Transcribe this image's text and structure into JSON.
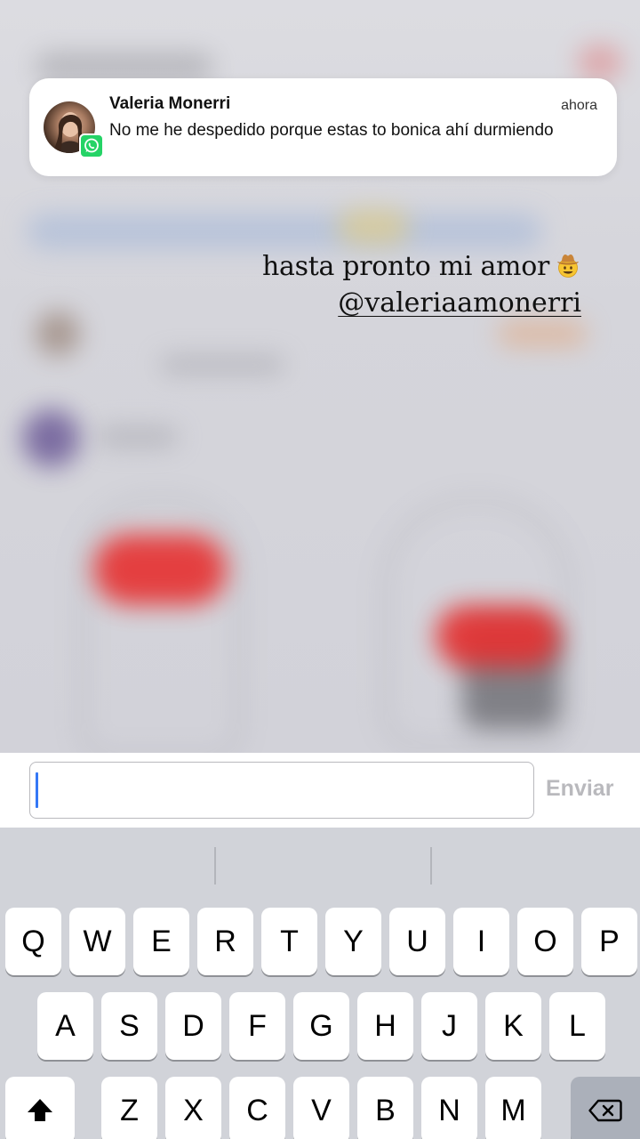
{
  "notification": {
    "sender": "Valeria Monerri",
    "time": "ahora",
    "message": "No me he despedido porque estas to bonica ahí durmiendo",
    "avatar_icon": "profile-photo",
    "app_icon": "whatsapp-icon"
  },
  "story": {
    "caption": "hasta pronto mi amor",
    "caption_emoji": "cowboy-hat-face-emoji",
    "mention": "@valeriaamonerri"
  },
  "reply": {
    "input_value": "",
    "send_label": "Enviar"
  },
  "keyboard": {
    "row1": [
      "Q",
      "W",
      "E",
      "R",
      "T",
      "Y",
      "U",
      "I",
      "O",
      "P"
    ],
    "row2": [
      "A",
      "S",
      "D",
      "F",
      "G",
      "H",
      "J",
      "K",
      "L"
    ],
    "row3": [
      "Z",
      "X",
      "C",
      "V",
      "B",
      "N",
      "M"
    ],
    "shift_icon": "shift-arrow-icon",
    "delete_icon": "backspace-icon"
  },
  "colors": {
    "whatsapp_green": "#25d366",
    "cursor_blue": "#3478f6",
    "send_disabled": "#b9b9bd",
    "keyboard_bg": "#d1d3d9"
  }
}
